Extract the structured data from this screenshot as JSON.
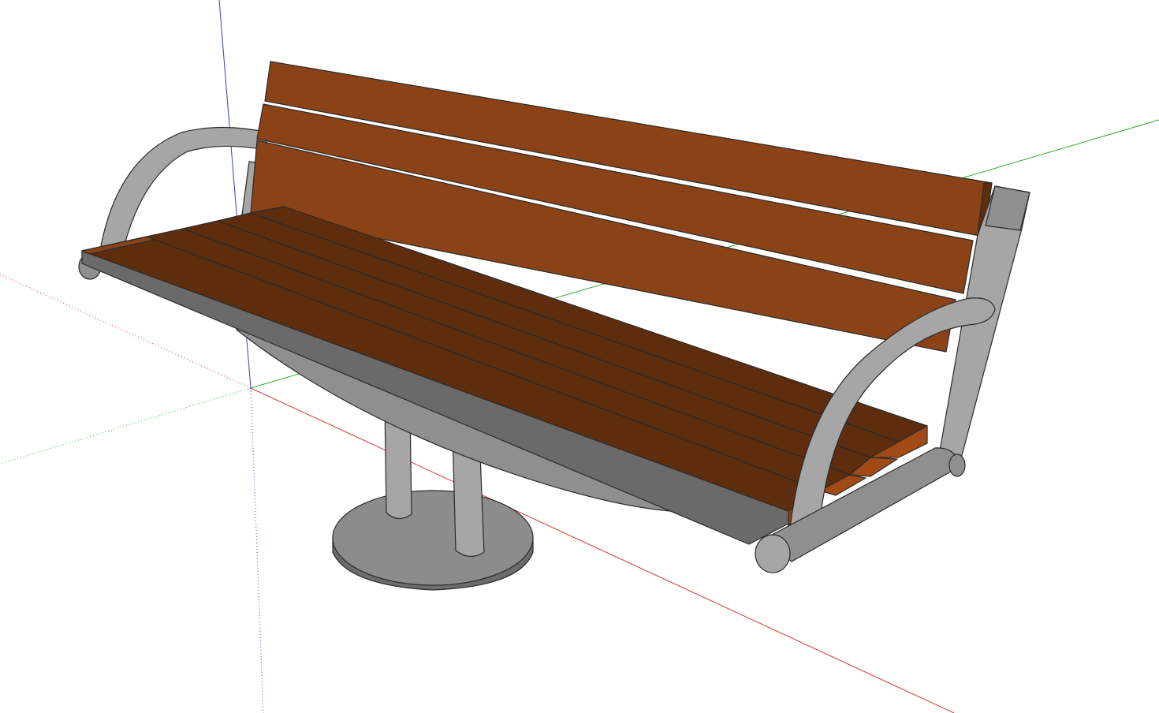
{
  "viewport": {
    "background": "#ffffff",
    "axes": {
      "red_axis_color": "#d23a3a",
      "green_axis_color": "#2faa2f",
      "blue_axis_color": "#3a3ad2",
      "solid_style": "solid",
      "hidden_style": "dotted"
    }
  },
  "model": {
    "object": "park-bench",
    "wood_colors": {
      "top_light": "#8a4216",
      "top_face": "#5e2d0e",
      "front_edge": "#a24a16",
      "back_face": "#8b4216"
    },
    "metal_colors": {
      "light": "#a6a6a6",
      "mid": "#8f8f8f",
      "dark": "#6a6a6a",
      "base_top": "#8c8c8c",
      "base_side": "#6c6c6c"
    },
    "backrest_slat_count": 3,
    "seat_slat_count": 6
  }
}
